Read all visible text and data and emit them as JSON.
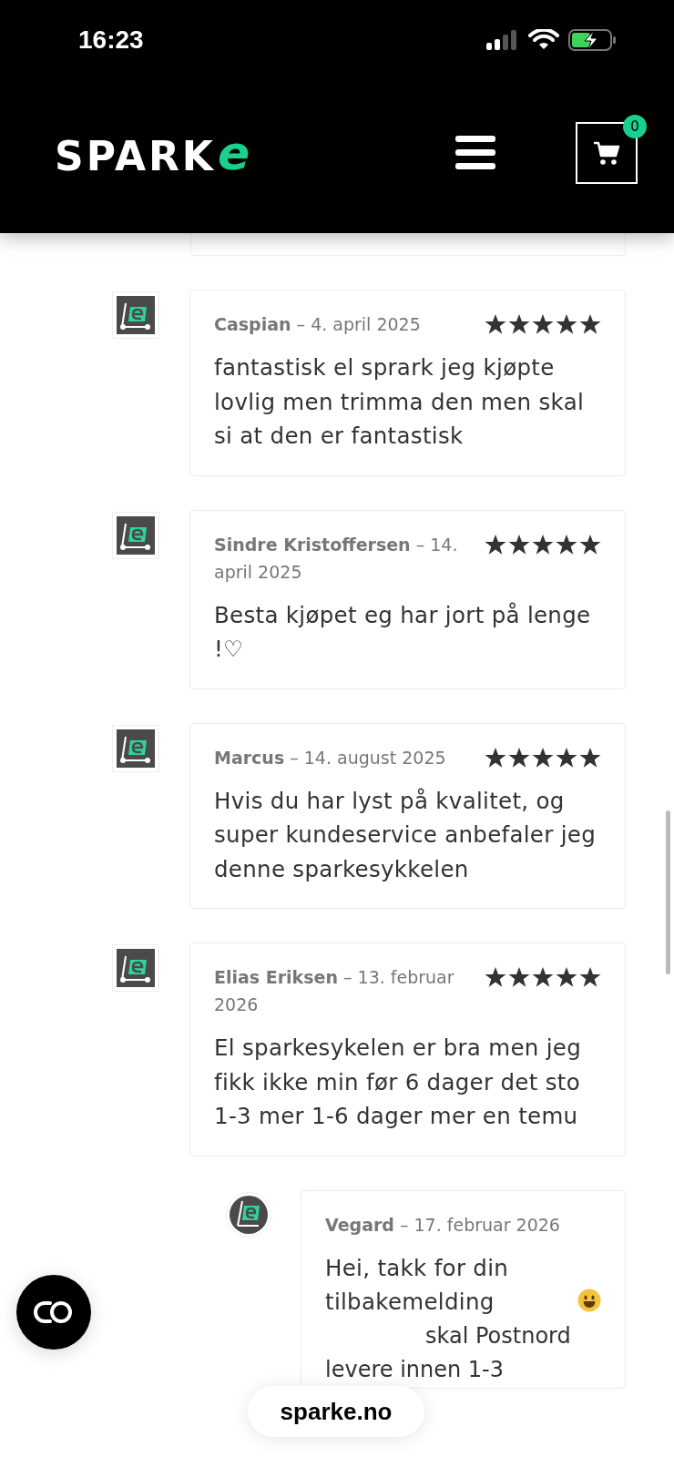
{
  "status_bar": {
    "time": "16:23"
  },
  "header": {
    "logo": {
      "text": "SPARK",
      "accent": "e"
    },
    "cart": {
      "count": "0"
    }
  },
  "reviews": [
    {
      "author": "Caspian",
      "date": "– 4. april 2025",
      "stars": 5,
      "text": "fantastisk el sprark jeg kjøpte lovlig men trimma den men skal si at den er fantastisk"
    },
    {
      "author": "Sindre Kristoffersen",
      "date": "– 14. april 2025",
      "stars": 5,
      "text": "Besta kjøpet eg har jort på lenge !♡"
    },
    {
      "author": "Marcus",
      "date": "– 14. august 2025",
      "stars": 5,
      "text": "Hvis du har lyst på kvalitet, og super kundeservice anbefaler jeg denne sparkesykkelen"
    },
    {
      "author": "Elias Eriksen",
      "date": "– 13. februar 2026",
      "stars": 5,
      "text": "El sparkesykelen er bra men jeg fikk ikke min før 6 dager det sto 1-3 mer 1-6 dager mer en temu"
    }
  ],
  "reply": {
    "author": "Vegard",
    "date": "– 17. februar 2026",
    "text": "Hei, takk for din tilbakemelding",
    "text_continued": "skal Postnord levere innen 1-3"
  },
  "url_pill": {
    "text": "sparke.no"
  }
}
